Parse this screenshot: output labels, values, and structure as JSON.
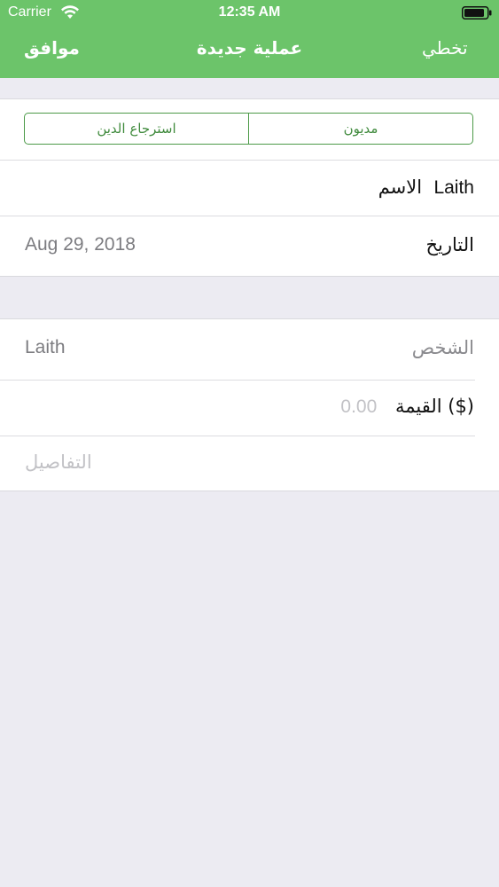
{
  "status_bar": {
    "carrier": "Carrier",
    "time": "12:35 AM",
    "icons": [
      "wifi-icon",
      "battery-icon"
    ]
  },
  "nav": {
    "left_button": "موافق",
    "title": "عملية جديدة",
    "right_button": "تخطي"
  },
  "segmented_control": {
    "options": [
      "استرجاع الدين",
      "مديون"
    ],
    "selected": "مديون"
  },
  "form": {
    "name": {
      "label": "الاسم",
      "value": "Laith"
    },
    "date": {
      "label": "التاريخ",
      "value": "Aug 29, 2018"
    },
    "person": {
      "label": "الشخص",
      "value": "Laith"
    },
    "amount": {
      "label": "القيمة ($)",
      "placeholder": "0.00"
    },
    "details": {
      "placeholder": "التفاصيل"
    }
  },
  "colors": {
    "header": "#6cc46a",
    "accent": "#4c9a48",
    "background": "#ecebf2"
  }
}
